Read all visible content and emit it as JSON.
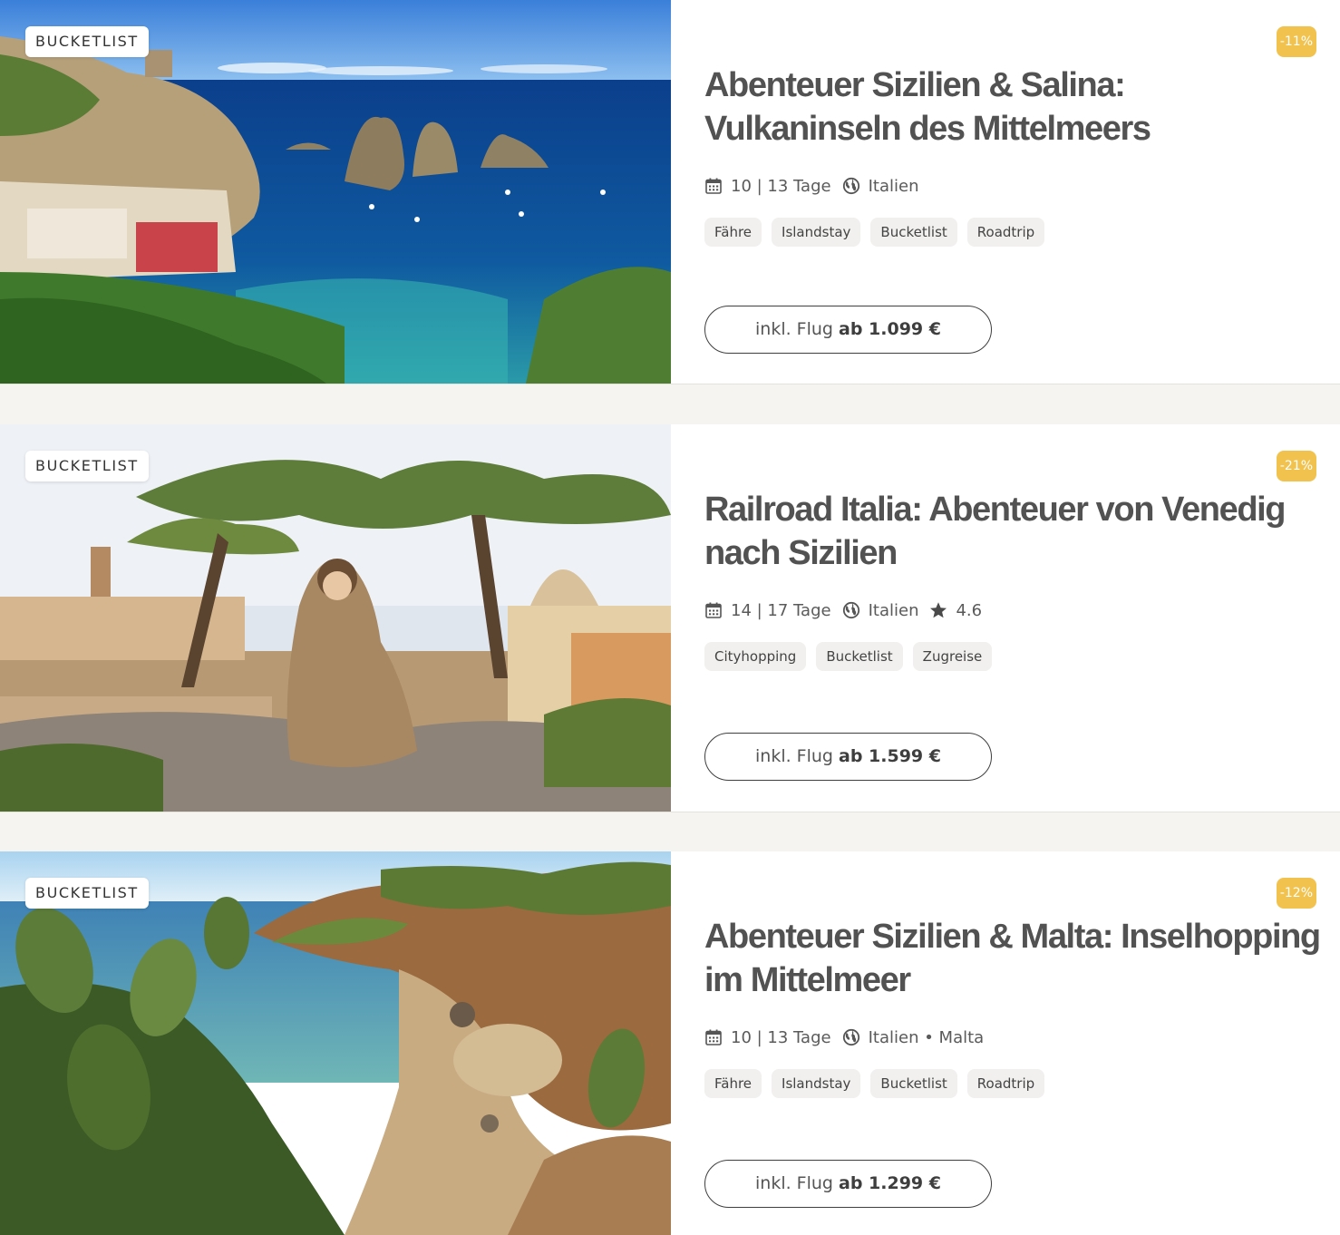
{
  "colors": {
    "accent_discount": "#f2c24e",
    "tag_bg": "#f1f0ee",
    "page_bg": "#f5f4f0",
    "title_text": "#525252"
  },
  "icons": {
    "duration": "calendar-icon",
    "country": "globe-icon",
    "rating": "star-icon"
  },
  "trips": [
    {
      "category": "BUCKETLIST",
      "discount": "-11%",
      "title": "Abenteuer Sizilien & Salina: Vulkaninseln des Mittelmeers",
      "duration": "10 | 13 Tage",
      "countries": "Italien",
      "tags": [
        "Fähre",
        "Islandstay",
        "Bucketlist",
        "Roadtrip"
      ],
      "price_prefix": "inkl. Flug",
      "price": "ab 1.099 €"
    },
    {
      "category": "BUCKETLIST",
      "discount": "-21%",
      "title": "Railroad Italia: Abenteuer von Venedig nach Sizilien",
      "duration": "14 | 17 Tage",
      "countries": "Italien",
      "rating": "4.6",
      "tags": [
        "Cityhopping",
        "Bucketlist",
        "Zugreise"
      ],
      "price_prefix": "inkl. Flug",
      "price": "ab 1.599 €"
    },
    {
      "category": "BUCKETLIST",
      "discount": "-12%",
      "title": "Abenteuer Sizilien & Malta: Inselhopping im Mittelmeer",
      "duration": "10 | 13 Tage",
      "countries": "Italien • Malta",
      "tags": [
        "Fähre",
        "Islandstay",
        "Bucketlist",
        "Roadtrip"
      ],
      "price_prefix": "inkl. Flug",
      "price": "ab 1.299 €"
    }
  ]
}
